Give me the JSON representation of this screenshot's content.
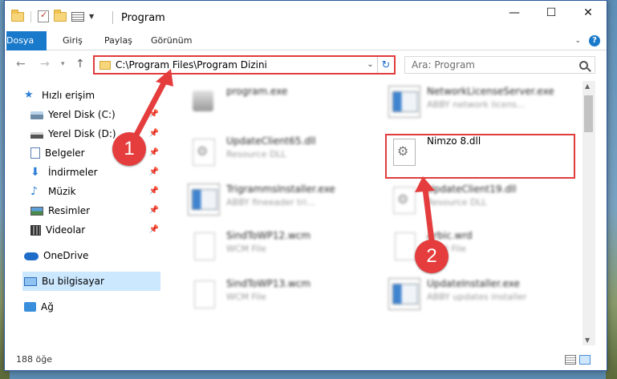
{
  "window": {
    "title": "Program"
  },
  "ribbon": {
    "tabs": [
      "Dosya",
      "Giriş",
      "Paylaş",
      "Görünüm"
    ]
  },
  "address": {
    "path": "C:\\Program Files\\Program Dizini",
    "search_placeholder": "Ara: Program"
  },
  "sidebar": {
    "quick_access": "Hızlı erişim",
    "items": [
      {
        "label": "Yerel Disk (C:)",
        "icon": "disk-c-icon"
      },
      {
        "label": "Yerel Disk (D:)",
        "icon": "disk-d-icon"
      },
      {
        "label": "Belgeler",
        "icon": "documents-icon"
      },
      {
        "label": "İndirmeler",
        "icon": "downloads-icon"
      },
      {
        "label": "Müzik",
        "icon": "music-icon"
      },
      {
        "label": "Resimler",
        "icon": "pictures-icon"
      },
      {
        "label": "Videolar",
        "icon": "videos-icon"
      }
    ],
    "onedrive": "OneDrive",
    "this_pc": "Bu bilgisayar",
    "network": "Ağ"
  },
  "files": [
    {
      "name": "program.exe",
      "desc": ""
    },
    {
      "name": "NetworkLicenseServer.exe",
      "desc": "ABBY network licens..."
    },
    {
      "name": "UpdateClient65.dll",
      "desc": "Resource DLL"
    },
    {
      "name": "Nimzo 8.dll",
      "desc": ""
    },
    {
      "name": "TrigrammsInstaller.exe",
      "desc": "ABBY fineeader tri..."
    },
    {
      "name": "UpdateClient19.dll",
      "desc": "Resource DLL"
    },
    {
      "name": "SindToWP12.wcm",
      "desc": "WCM File"
    },
    {
      "name": "Arbic.wrd",
      "desc": "WRD File"
    },
    {
      "name": "SindToWP13.wcm",
      "desc": "WCM File"
    },
    {
      "name": "UpdateInstaller.exe",
      "desc": "ABBY updates installer"
    }
  ],
  "status": {
    "count": "188 öğe"
  },
  "annotations": {
    "step1": "1",
    "step2": "2"
  },
  "colors": {
    "accent": "#1979ca",
    "annotation_red": "#e53d3d",
    "selected_bg": "#cce8ff"
  }
}
